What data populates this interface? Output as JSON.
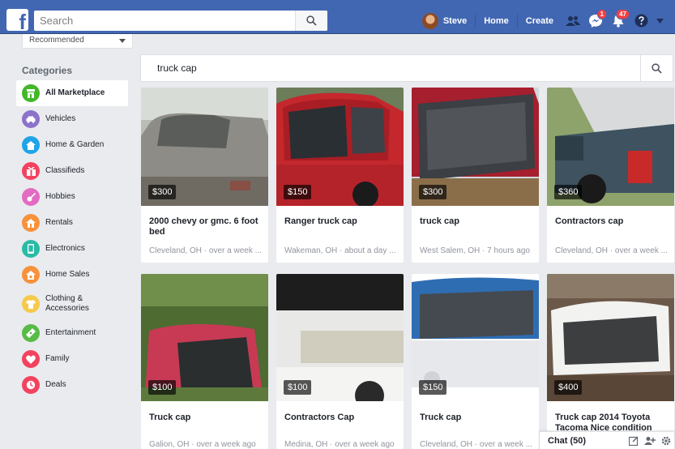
{
  "topbar": {
    "logo": "f",
    "search_placeholder": "Search",
    "user_name": "Steve",
    "home_label": "Home",
    "create_label": "Create",
    "messages_badge": "1",
    "notifications_badge": "47"
  },
  "sort": {
    "selected": "Recommended"
  },
  "categories": {
    "title": "Categories",
    "items": [
      {
        "label": "All Marketplace",
        "color": "#42b72a"
      },
      {
        "label": "Vehicles",
        "color": "#8c72cb"
      },
      {
        "label": "Home & Garden",
        "color": "#1fa4e8"
      },
      {
        "label": "Classifieds",
        "color": "#f3425f"
      },
      {
        "label": "Hobbies",
        "color": "#e36bc3"
      },
      {
        "label": "Rentals",
        "color": "#f7923b"
      },
      {
        "label": "Electronics",
        "color": "#2abba7"
      },
      {
        "label": "Home Sales",
        "color": "#f7923b"
      },
      {
        "label": "Clothing & Accessories",
        "color": "#f7c94b"
      },
      {
        "label": "Entertainment",
        "color": "#57bb47"
      },
      {
        "label": "Family",
        "color": "#f3425f"
      },
      {
        "label": "Deals",
        "color": "#f3425f"
      }
    ]
  },
  "main_search": {
    "value": "truck cap"
  },
  "listings": [
    {
      "price": "$300",
      "title": "2000 chevy or gmc. 6 foot bed",
      "location": "Cleveland, OH · over a week ..."
    },
    {
      "price": "$150",
      "title": "Ranger truck cap",
      "location": "Wakeman, OH · about a day ..."
    },
    {
      "price": "$300",
      "title": "truck cap",
      "location": "West Salem, OH · 7 hours ago"
    },
    {
      "price": "$360",
      "title": "Contractors cap",
      "location": "Cleveland, OH · over a week ..."
    },
    {
      "price": "$100",
      "title": "Truck cap",
      "location": "Galion, OH · over a week ago"
    },
    {
      "price": "$100",
      "title": "Contractors Cap",
      "location": "Medina, OH · over a week ago"
    },
    {
      "price": "$150",
      "title": "Truck cap",
      "location": "Cleveland, OH · over a week ..."
    },
    {
      "price": "$400",
      "title": "Truck cap 2014 Toyota Tacoma Nice condition",
      "location": ""
    }
  ],
  "chat": {
    "label": "Chat (50)"
  },
  "colors": {
    "brand": "#4267b2",
    "background": "#e9ebee",
    "badge": "#fa3e3e"
  }
}
